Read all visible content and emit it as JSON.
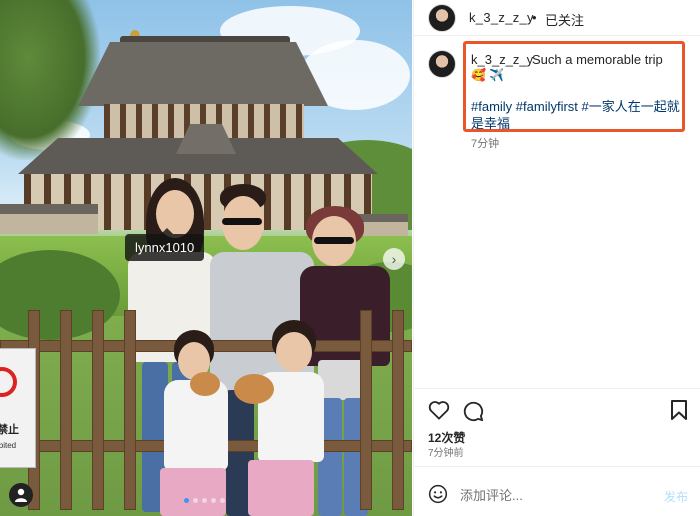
{
  "photo": {
    "tag_label": "lynnx1010",
    "sign_text": "禁止",
    "sign_subtext": "ibited",
    "carousel": {
      "count": 5,
      "active_index": 0
    },
    "next_icon": "chevron-right-icon",
    "user_tag_icon": "person-icon"
  },
  "header": {
    "username": "k_3_z_z_y",
    "separator": "•",
    "follow_status": "已关注"
  },
  "caption": {
    "username": "k_3_z_z_y",
    "text": "Such a memorable trip",
    "emoji": "🥰 ✈️",
    "hashtags": "#family #familyfirst #一家人在一起就是幸福",
    "time": "7分钟",
    "highlight_color": "#e8562a"
  },
  "actions": {
    "like_icon": "heart-icon",
    "comment_icon": "comment-icon",
    "save_icon": "bookmark-icon",
    "likes": "12次赞",
    "time": "7分钟前"
  },
  "comment": {
    "emoji_icon": "smiley-icon",
    "placeholder": "添加评论...",
    "post_label": "发布"
  }
}
